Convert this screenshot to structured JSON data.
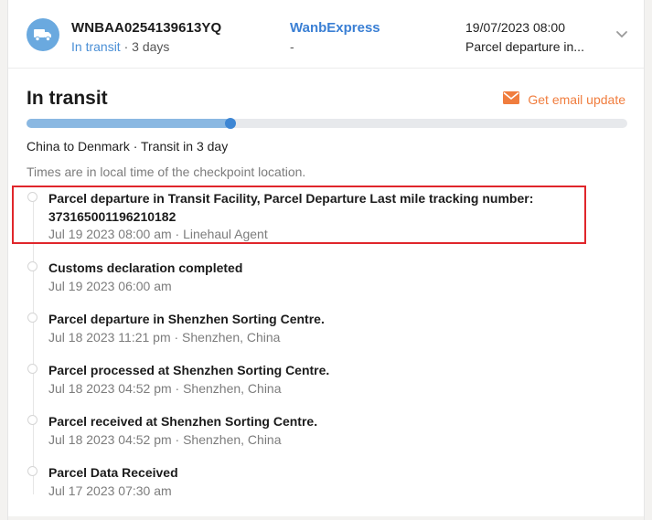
{
  "shipment": {
    "tracking_number": "WNBAA0254139613YQ",
    "status": "In transit",
    "duration": "3 days",
    "carrier": "WanbExpress",
    "carrier_sub": "-",
    "latest_time": "19/07/2023 08:00",
    "latest_event": "Parcel departure in..."
  },
  "detail": {
    "title": "In transit",
    "email_label": "Get email update",
    "progress_percent": 34,
    "route": "China to Denmark · Transit in 3 day",
    "timezone_note": "Times are in local time of the checkpoint location."
  },
  "events": [
    {
      "title_line1": "Parcel departure in Transit Facility, Parcel Departure Last mile tracking number:",
      "title_line2": "373165001196210182",
      "meta": "Jul 19 2023 08:00 am · Linehaul Agent"
    },
    {
      "title": "Customs declaration completed",
      "meta": "Jul 19 2023 06:00 am"
    },
    {
      "title": "Parcel departure in Shenzhen Sorting Centre.",
      "meta": "Jul 18 2023 11:21 pm · Shenzhen, China"
    },
    {
      "title": "Parcel processed at Shenzhen Sorting Centre.",
      "meta": "Jul 18 2023 04:52 pm · Shenzhen, China"
    },
    {
      "title": "Parcel received at Shenzhen Sorting Centre.",
      "meta": "Jul 18 2023 04:52 pm · Shenzhen, China"
    },
    {
      "title": "Parcel Data Received",
      "meta": "Jul 17 2023 07:30 am"
    }
  ],
  "colors": {
    "accent_blue": "#3a7fd4",
    "email_orange": "#f07d3e",
    "highlight_red": "#e0262b"
  },
  "icons": [
    "truck-icon",
    "chevron-down-icon",
    "mail-icon"
  ]
}
